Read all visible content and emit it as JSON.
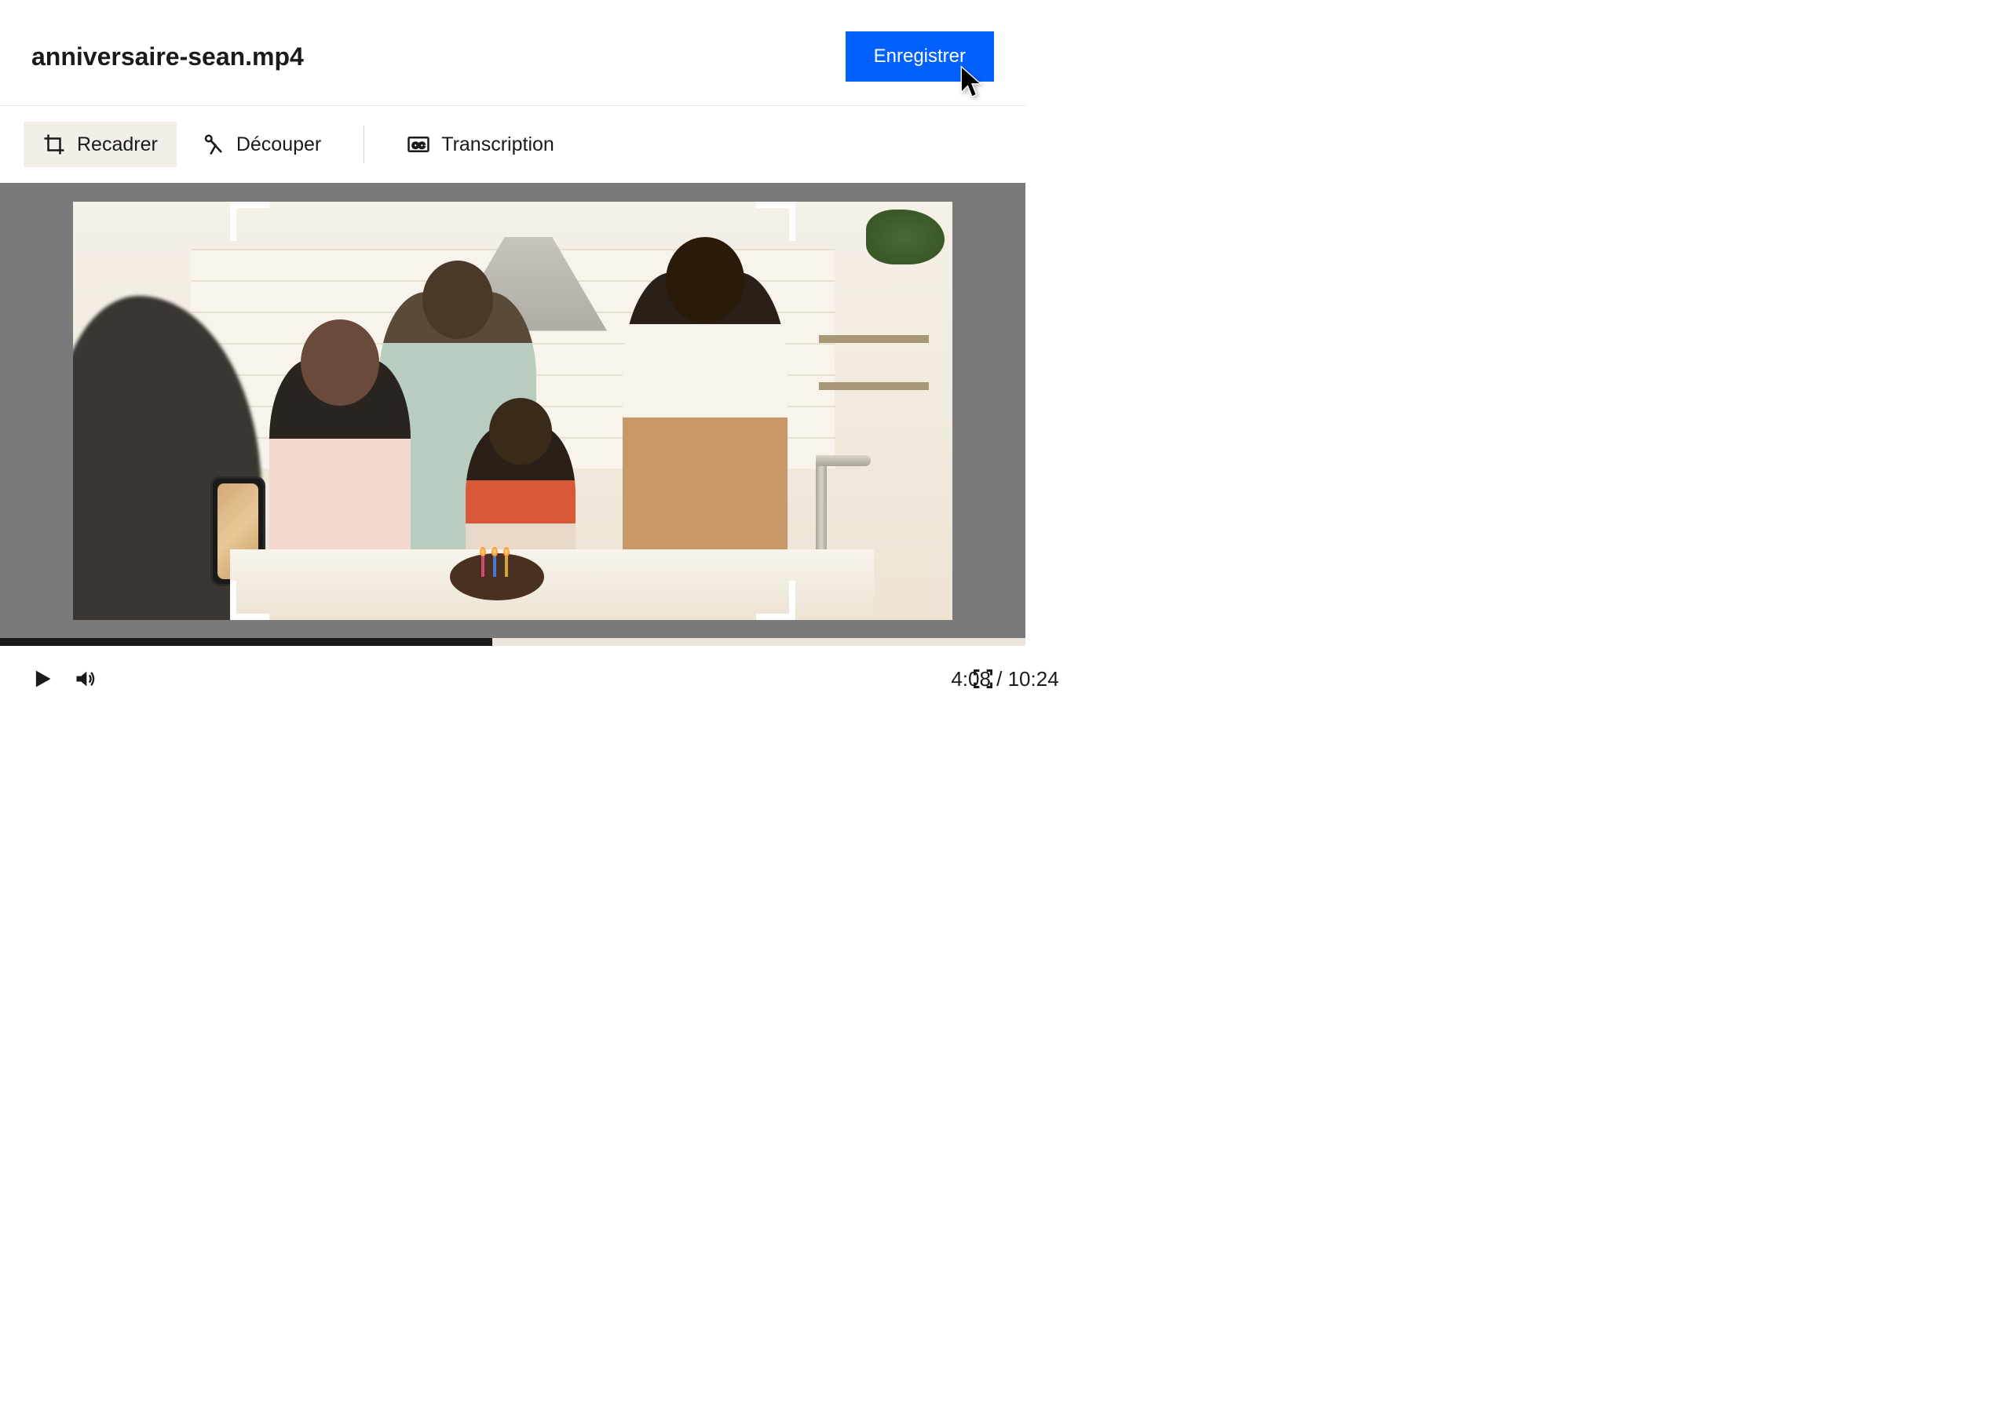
{
  "header": {
    "file_name": "anniversaire-sean.mp4",
    "save_label": "Enregistrer"
  },
  "toolbar": {
    "crop_label": "Recadrer",
    "trim_label": "Découper",
    "transcription_label": "Transcription",
    "active_tool": "crop"
  },
  "playback": {
    "current_time": "4:08",
    "total_time": "10:24",
    "progress_percent": 48
  }
}
